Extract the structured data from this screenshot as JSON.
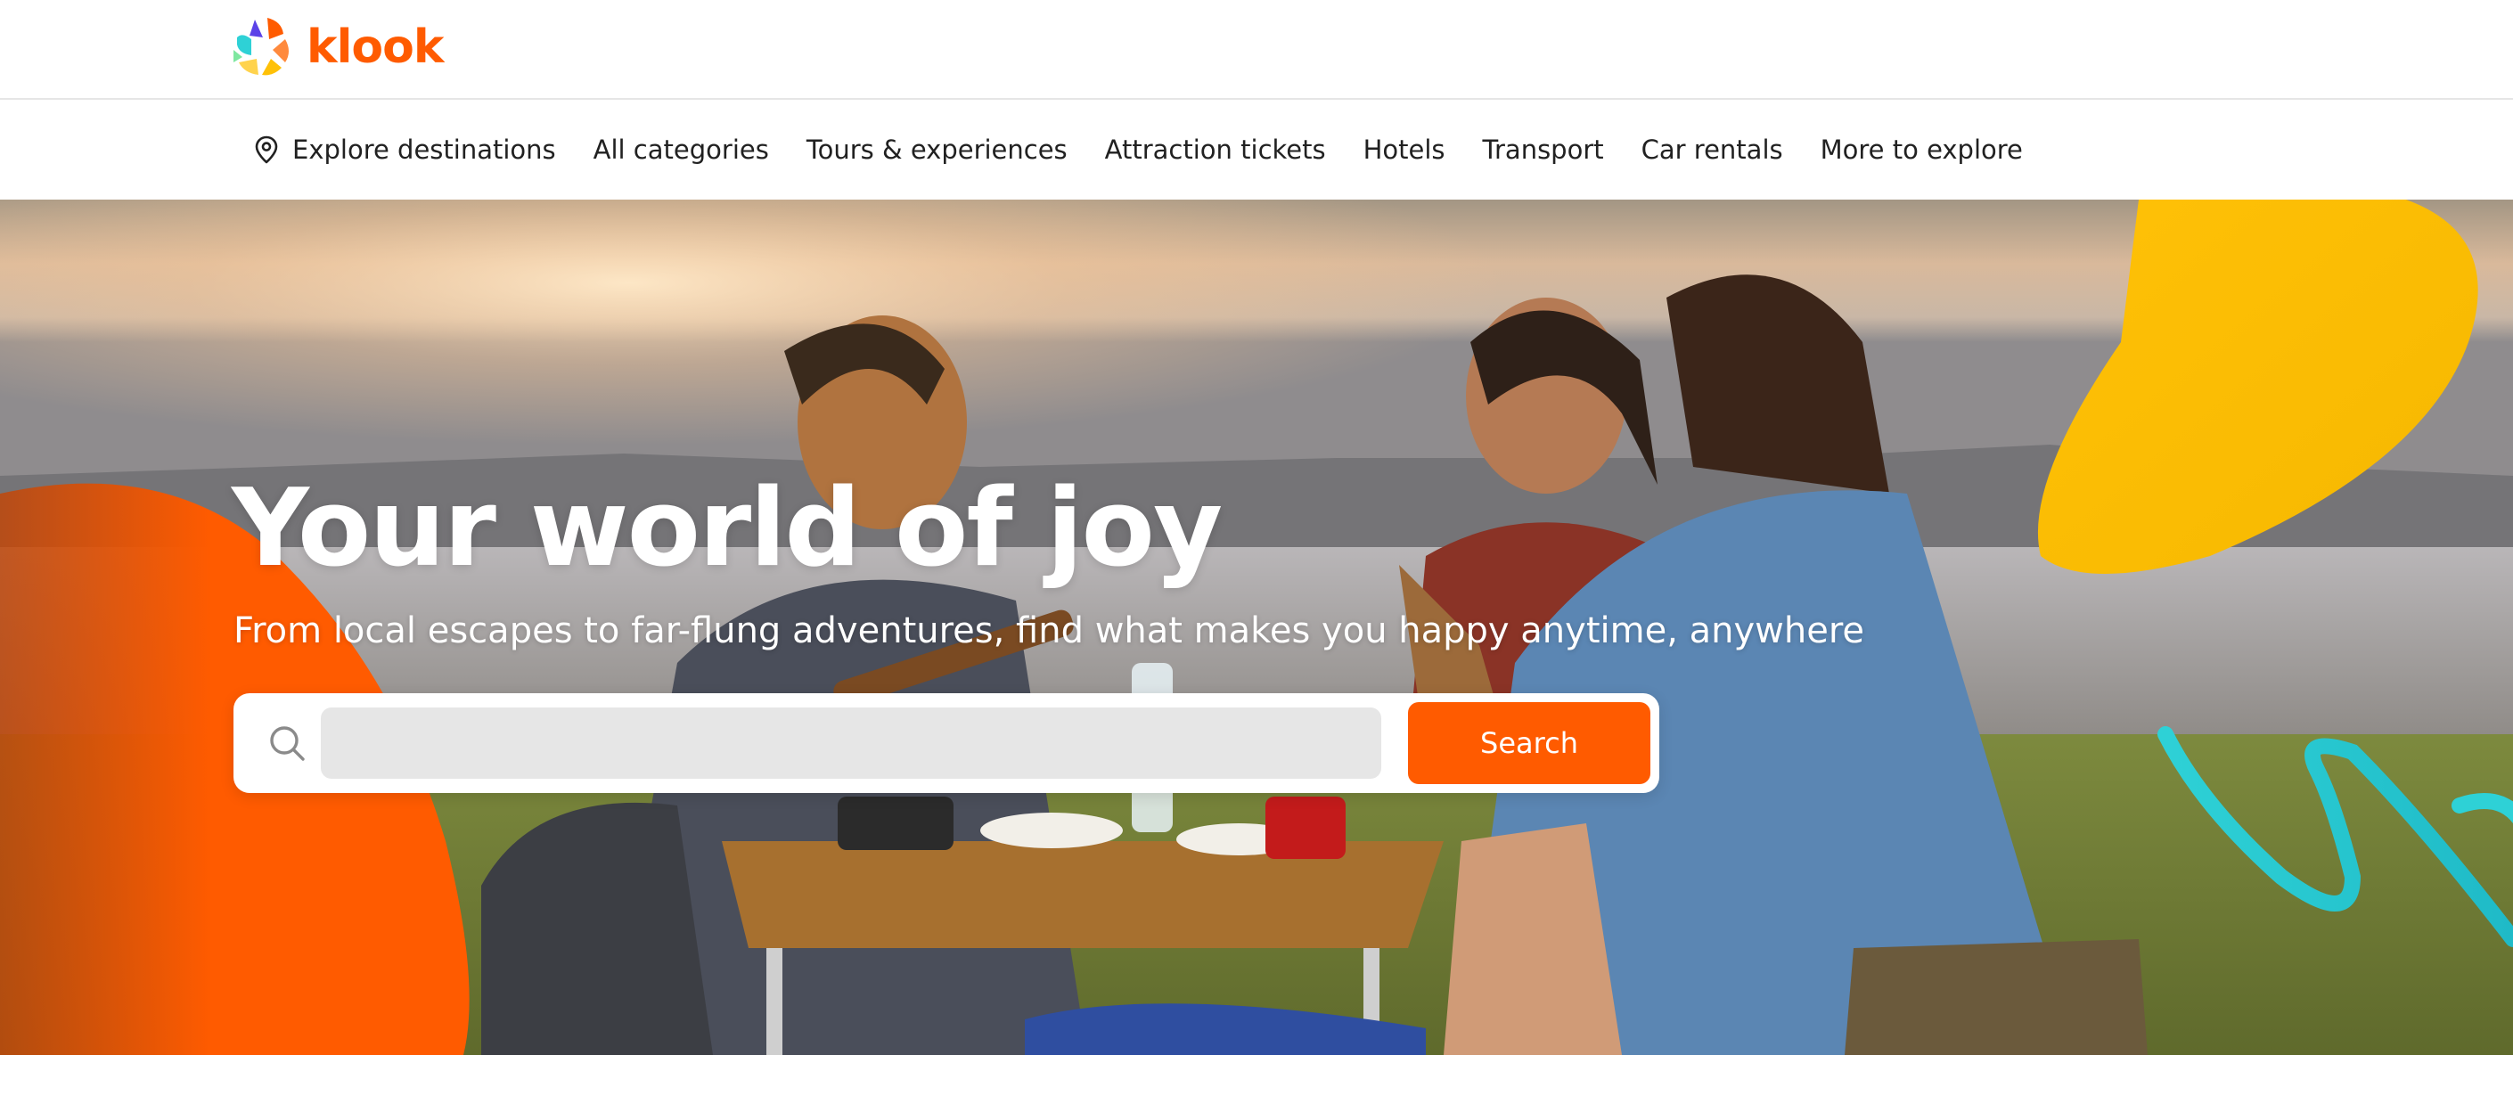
{
  "brand": {
    "name": "klook",
    "color": "#ff5b00",
    "logo_icon": "klook-logo-icon"
  },
  "nav": {
    "items": [
      {
        "label": "Explore destinations",
        "icon": "location-pin-icon"
      },
      {
        "label": "All categories"
      },
      {
        "label": "Tours & experiences"
      },
      {
        "label": "Attraction tickets"
      },
      {
        "label": "Hotels"
      },
      {
        "label": "Transport"
      },
      {
        "label": "Car rentals"
      },
      {
        "label": "More to explore"
      }
    ]
  },
  "hero": {
    "title": "Your world of joy",
    "subtitle": "From local escapes to far-flung adventures, find what makes you happy anytime, anywhere",
    "image": "hero-photo-friends-picnic-by-lake",
    "decor_colors": {
      "orange": "#ff5b00",
      "yellow": "#ffc107",
      "teal": "#2ed1d6"
    }
  },
  "search": {
    "icon": "search-icon",
    "placeholder": "",
    "value": "",
    "button_label": "Search"
  }
}
